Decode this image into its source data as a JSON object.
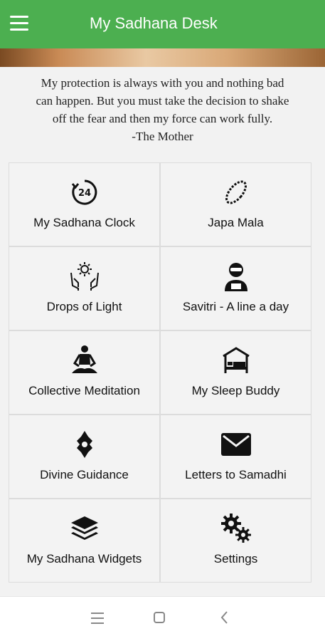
{
  "app": {
    "title": "My Sadhana Desk"
  },
  "colors": {
    "appbar": "#4caf50",
    "background": "#f2f2f2",
    "tile": "#f3f3f3"
  },
  "quote": {
    "lines": [
      "My protection is always with you and nothing bad",
      "can happen. But you must take the decision to shake",
      "off the fear and then my force can work fully.",
      "-The Mother"
    ]
  },
  "tiles": [
    {
      "label": "My Sadhana Clock",
      "icon": "clock-24-icon"
    },
    {
      "label": "Japa Mala",
      "icon": "mala-beads-icon"
    },
    {
      "label": "Drops of Light",
      "icon": "praying-hands-icon"
    },
    {
      "label": "Savitri - A line a day",
      "icon": "reader-icon"
    },
    {
      "label": "Collective Meditation",
      "icon": "meditation-icon"
    },
    {
      "label": "My Sleep Buddy",
      "icon": "bed-icon"
    },
    {
      "label": "Divine Guidance",
      "icon": "divine-symbol-icon"
    },
    {
      "label": "Letters to Samadhi",
      "icon": "envelope-icon"
    },
    {
      "label": "My Sadhana Widgets",
      "icon": "layers-icon"
    },
    {
      "label": "Settings",
      "icon": "gears-icon"
    }
  ],
  "navbar": {
    "items": [
      "recent-apps",
      "home",
      "back"
    ]
  }
}
